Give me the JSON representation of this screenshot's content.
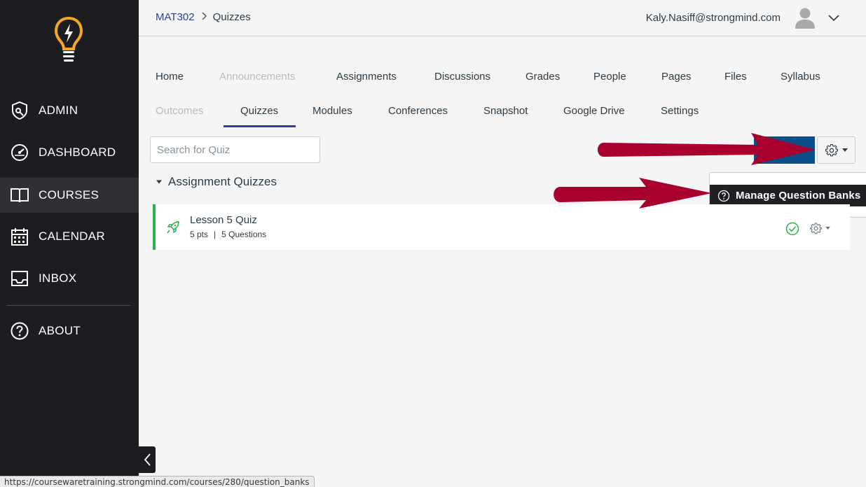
{
  "sidebar": {
    "items": [
      {
        "label": "ADMIN",
        "icon": "shield-icon"
      },
      {
        "label": "DASHBOARD",
        "icon": "speedometer-icon"
      },
      {
        "label": "COURSES",
        "icon": "book-icon"
      },
      {
        "label": "CALENDAR",
        "icon": "calendar-icon"
      },
      {
        "label": "INBOX",
        "icon": "inbox-icon"
      },
      {
        "label": "ABOUT",
        "icon": "question-icon"
      }
    ],
    "active": "COURSES"
  },
  "header": {
    "course": "MAT302",
    "current": "Quizzes",
    "user_email": "Kaly.Nasiff@strongmind.com"
  },
  "course_nav": {
    "row1": [
      "Home",
      "Announcements",
      "Assignments",
      "Discussions",
      "Grades",
      "People",
      "Pages",
      "Files",
      "Syllabus"
    ],
    "row2": [
      "Outcomes",
      "Quizzes",
      "Modules",
      "Conferences",
      "Snapshot",
      "Google Drive",
      "Settings"
    ],
    "active": "Quizzes",
    "disabled": [
      "Announcements",
      "Outcomes"
    ]
  },
  "toolbar": {
    "search_placeholder": "Search for Quiz"
  },
  "dropdown": {
    "item": "Manage Question Banks"
  },
  "section": {
    "title": "Assignment Quizzes"
  },
  "quiz": {
    "title": "Lesson 5 Quiz",
    "points": "5 pts",
    "meta_sep": "|",
    "questions": "5 Questions"
  },
  "status_bar": {
    "url": "https://coursewaretraining.strongmind.com/courses/280/question_banks"
  },
  "colors": {
    "sidebar_bg": "#1b1d20",
    "brand_orange": "#f5a623",
    "link_blue": "#2b3ea1",
    "primary_button": "#0b4f89",
    "published_green": "#2bb24c",
    "annotation_arrow": "#a8002f"
  }
}
